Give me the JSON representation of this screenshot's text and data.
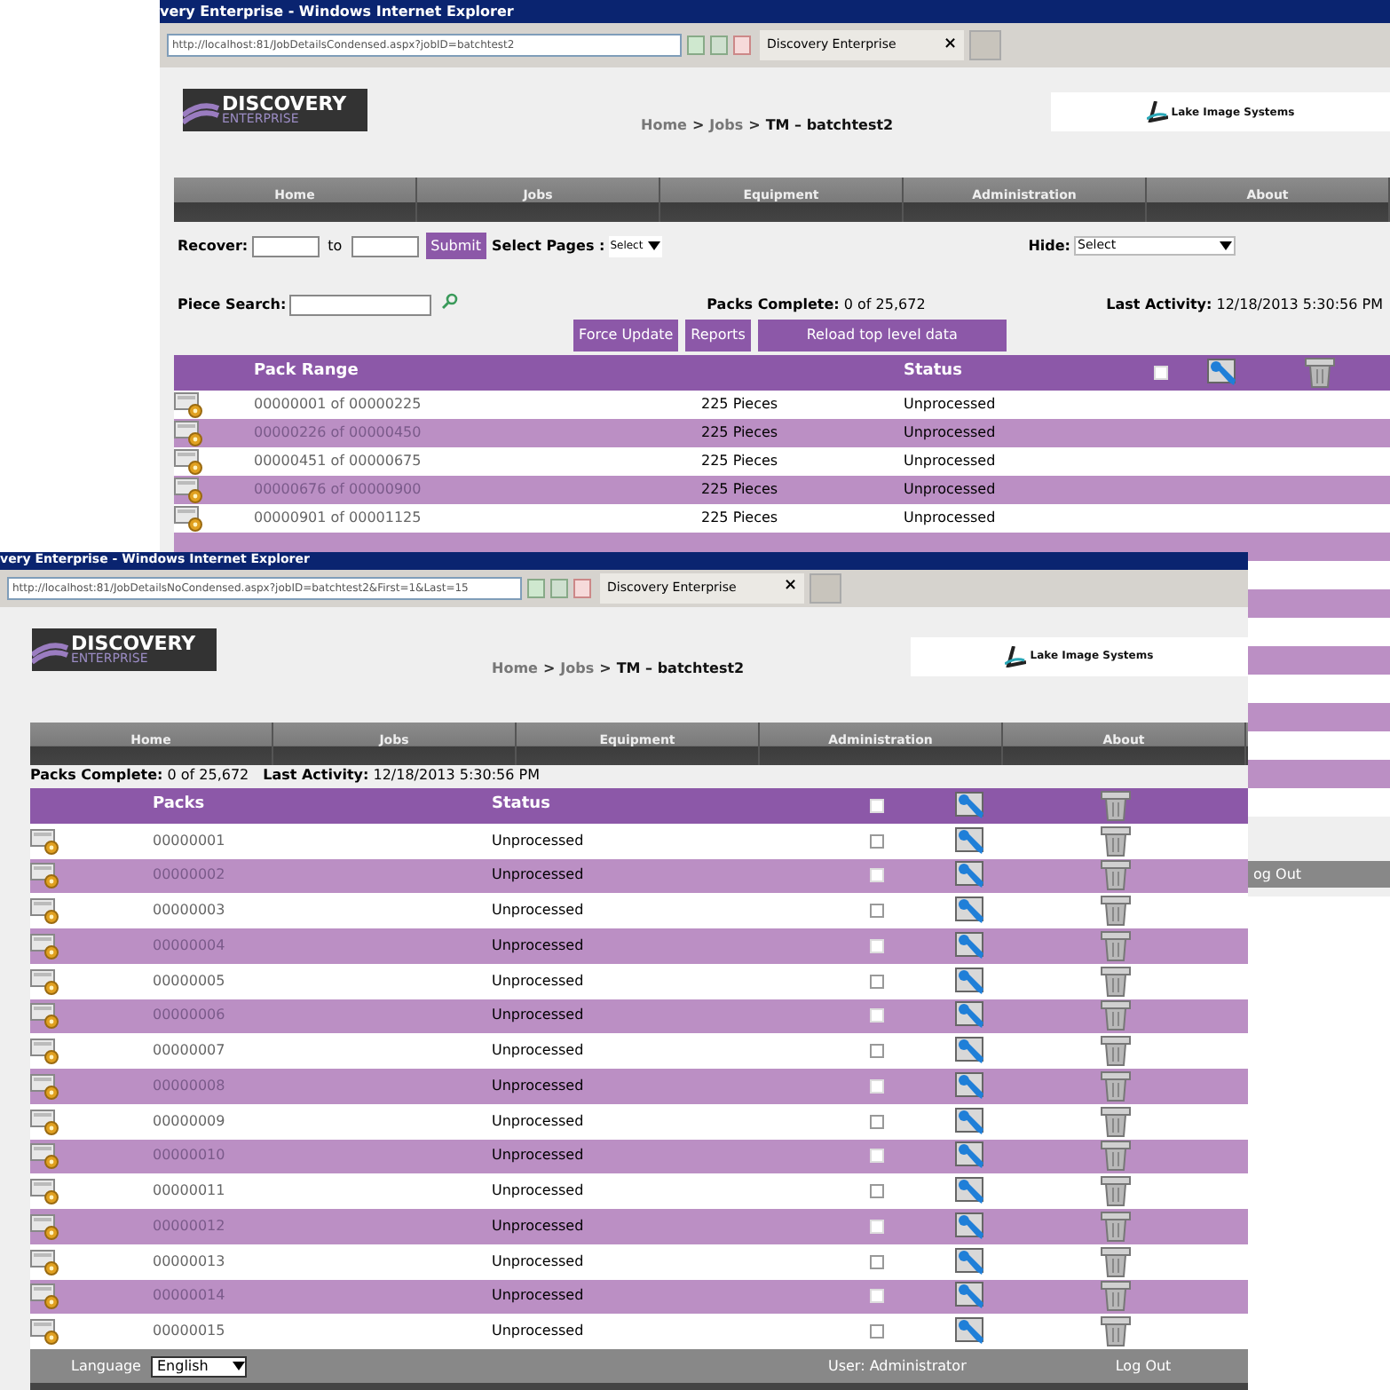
{
  "back_window": {
    "title": "very Enterprise - Windows Internet Explorer",
    "address": "http://localhost:81/JobDetailsCondensed.aspx?jobID=batchtest2",
    "tab": {
      "label": "Discovery Enterprise",
      "close": "×"
    },
    "logo": {
      "title": "DISCOVERY",
      "subtitle": "ENTERPRISE"
    },
    "breadcrumb": [
      {
        "kind": "link",
        "text": "Home"
      },
      {
        "kind": "sep",
        "text": ">"
      },
      {
        "kind": "link",
        "text": "Jobs"
      },
      {
        "kind": "sep",
        "text": ">"
      },
      {
        "kind": "current",
        "text": "TM – batchtest2"
      }
    ],
    "partner": "Lake Image Systems",
    "nav": [
      "Home",
      "Jobs",
      "Equipment",
      "Administration",
      "About"
    ],
    "recover": {
      "label": "Recover:",
      "to": "to",
      "submit": "Submit"
    },
    "select_pages": {
      "label": "Select Pages :",
      "value": "Select"
    },
    "hide": {
      "label": "Hide:",
      "value": "Select"
    },
    "piece_search": {
      "label": "Piece Search:"
    },
    "packs_complete": "**Packs Complete:** 0 of 25,672",
    "last_activity": "**Last Activity:** 12/18/2013 5:30:56 PM",
    "buttons": [
      "Force Update",
      "Reports",
      "Reload top level data"
    ],
    "table": {
      "columns": [
        "Pack Range",
        "Status"
      ],
      "header_checked": false,
      "rows": [
        {
          "range": "00000001 of 00000225",
          "pieces": "225 Pieces",
          "status": "Unprocessed"
        },
        {
          "range": "00000226 of 00000450",
          "pieces": "225 Pieces",
          "status": "Unprocessed"
        },
        {
          "range": "00000451 of 00000675",
          "pieces": "225 Pieces",
          "status": "Unprocessed"
        },
        {
          "range": "00000676 of 00000900",
          "pieces": "225 Pieces",
          "status": "Unprocessed"
        },
        {
          "range": "00000901 of 00001125",
          "pieces": "225 Pieces",
          "status": "Unprocessed"
        }
      ]
    },
    "footer_logout": "og Out"
  },
  "front_window": {
    "title": "very Enterprise - Windows Internet Explorer",
    "address": "http://localhost:81/JobDetailsNoCondensed.aspx?jobID=batchtest2&First=1&Last=15",
    "tab": {
      "label": "Discovery Enterprise",
      "close": "×"
    },
    "logo": {
      "title": "DISCOVERY",
      "subtitle": "ENTERPRISE"
    },
    "breadcrumb": [
      {
        "kind": "link",
        "text": "Home"
      },
      {
        "kind": "sep",
        "text": ">"
      },
      {
        "kind": "link",
        "text": "Jobs"
      },
      {
        "kind": "sep",
        "text": ">"
      },
      {
        "kind": "current",
        "text": "TM – batchtest2"
      }
    ],
    "partner": "Lake Image Systems",
    "nav": [
      "Home",
      "Jobs",
      "Equipment",
      "Administration",
      "About"
    ],
    "packs_complete": "**Packs Complete:** 0 of 25,672",
    "last_activity": "**Last Activity:** 12/18/2013 5:30:56 PM",
    "table": {
      "columns": [
        "Packs",
        "Status"
      ],
      "header_checked": false,
      "rows": [
        {
          "pack": "00000001",
          "status": "Unprocessed",
          "checked": false
        },
        {
          "pack": "00000002",
          "status": "Unprocessed",
          "checked": false
        },
        {
          "pack": "00000003",
          "status": "Unprocessed",
          "checked": false
        },
        {
          "pack": "00000004",
          "status": "Unprocessed",
          "checked": false
        },
        {
          "pack": "00000005",
          "status": "Unprocessed",
          "checked": false
        },
        {
          "pack": "00000006",
          "status": "Unprocessed",
          "checked": false
        },
        {
          "pack": "00000007",
          "status": "Unprocessed",
          "checked": false
        },
        {
          "pack": "00000008",
          "status": "Unprocessed",
          "checked": false
        },
        {
          "pack": "00000009",
          "status": "Unprocessed",
          "checked": false
        },
        {
          "pack": "00000010",
          "status": "Unprocessed",
          "checked": false
        },
        {
          "pack": "00000011",
          "status": "Unprocessed",
          "checked": false
        },
        {
          "pack": "00000012",
          "status": "Unprocessed",
          "checked": false
        },
        {
          "pack": "00000013",
          "status": "Unprocessed",
          "checked": false
        },
        {
          "pack": "00000014",
          "status": "Unprocessed",
          "checked": false
        },
        {
          "pack": "00000015",
          "status": "Unprocessed",
          "checked": false
        }
      ]
    },
    "footer": {
      "language_label": "Language",
      "language": "English",
      "user": "User: Administrator",
      "logout": "Log Out"
    }
  }
}
